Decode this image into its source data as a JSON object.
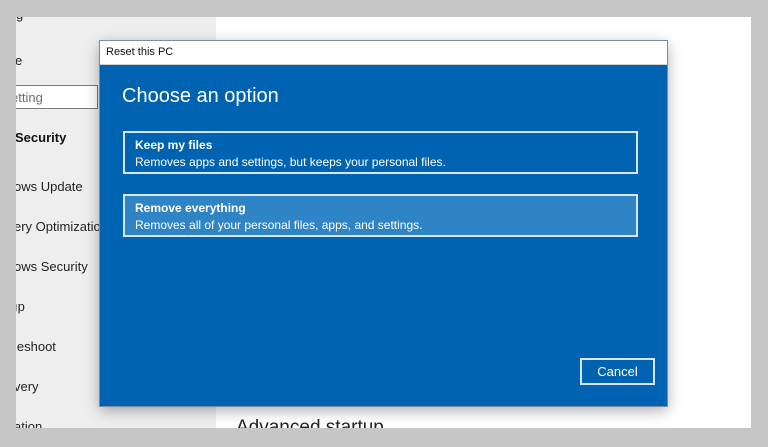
{
  "sidebar": {
    "top_partial": "g",
    "item_partial": "e",
    "search": {
      "placeholder": "etting"
    },
    "heading": "Security",
    "items": [
      {
        "label": "ows Update"
      },
      {
        "label": "ery Optimization"
      },
      {
        "label": "ows Security"
      },
      {
        "label": "ıp"
      },
      {
        "label": "leshoot"
      },
      {
        "label": "very"
      },
      {
        "label": "ation"
      }
    ]
  },
  "main": {
    "section_title": "Advanced startup"
  },
  "dialog": {
    "title": "Reset this PC",
    "heading": "Choose an option",
    "options": [
      {
        "title": "Keep my files",
        "description": "Removes apps and settings, but keeps your personal files."
      },
      {
        "title": "Remove everything",
        "description": "Removes all of your personal files, apps, and settings."
      }
    ],
    "cancel_label": "Cancel",
    "colors": {
      "dialog_background": "#0063b1",
      "highlight": "#2f84c6",
      "border": "#d6e6f5"
    }
  }
}
